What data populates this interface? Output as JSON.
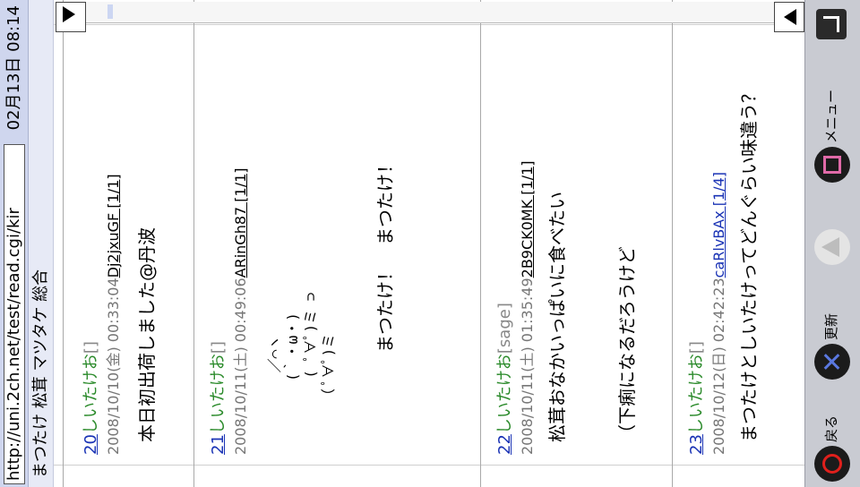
{
  "url_bar": {
    "value": "http://uni.2ch.net/test/read.cgi/kir"
  },
  "clock": {
    "text": "02月13日 08:14"
  },
  "thread_title": "まつたけ 松茸 マツタケ 総合",
  "posts": [
    {
      "num": "20",
      "name": "しいたけお",
      "mail": "[]",
      "meta_prefix": "2008/10/10(金) 00:33:04",
      "id_text": "Dj2jxuGF [1/1]",
      "body": "本日初出荷しました@丹波"
    },
    {
      "num": "21",
      "name": "しいたけお",
      "mail": "[]",
      "meta_prefix": "2008/10/11(土) 00:49:06",
      "id_text": "ARinGh87 [1/1]",
      "aa": " 　　／⌒ヽ\n　　(｀・ω・)\n　  ( ﾟ∀ﾟ)ミ ⊃\n　（ ﾟ∀ﾟ)ミ",
      "body": "まつたけ！　まつたけ！"
    },
    {
      "num": "22",
      "name": "しいたけお",
      "mail": "[sage]",
      "meta_prefix": "2008/10/11(土) 01:35:49",
      "id_text": "2B9CK0MK [1/1]",
      "body": "松茸おなかいっぱいに食べたい\n\n\n（下痢になるだろうけど"
    },
    {
      "num": "23",
      "name": "しいたけお",
      "mail": "[]",
      "meta_prefix": "2008/10/12(日) 02:42:23",
      "id_text": "caRlvBAx [1/4]",
      "body": "まつたけとしいたけってどんぐらい味違う？"
    }
  ],
  "nav": {
    "back_label": "戻る",
    "refresh_label": "更新",
    "menu_label": "メニュー"
  },
  "colors": {
    "accent": "#e0201c",
    "bar": "#cfd6ee",
    "link": "#1a33b5",
    "name": "#2a8a2a"
  }
}
